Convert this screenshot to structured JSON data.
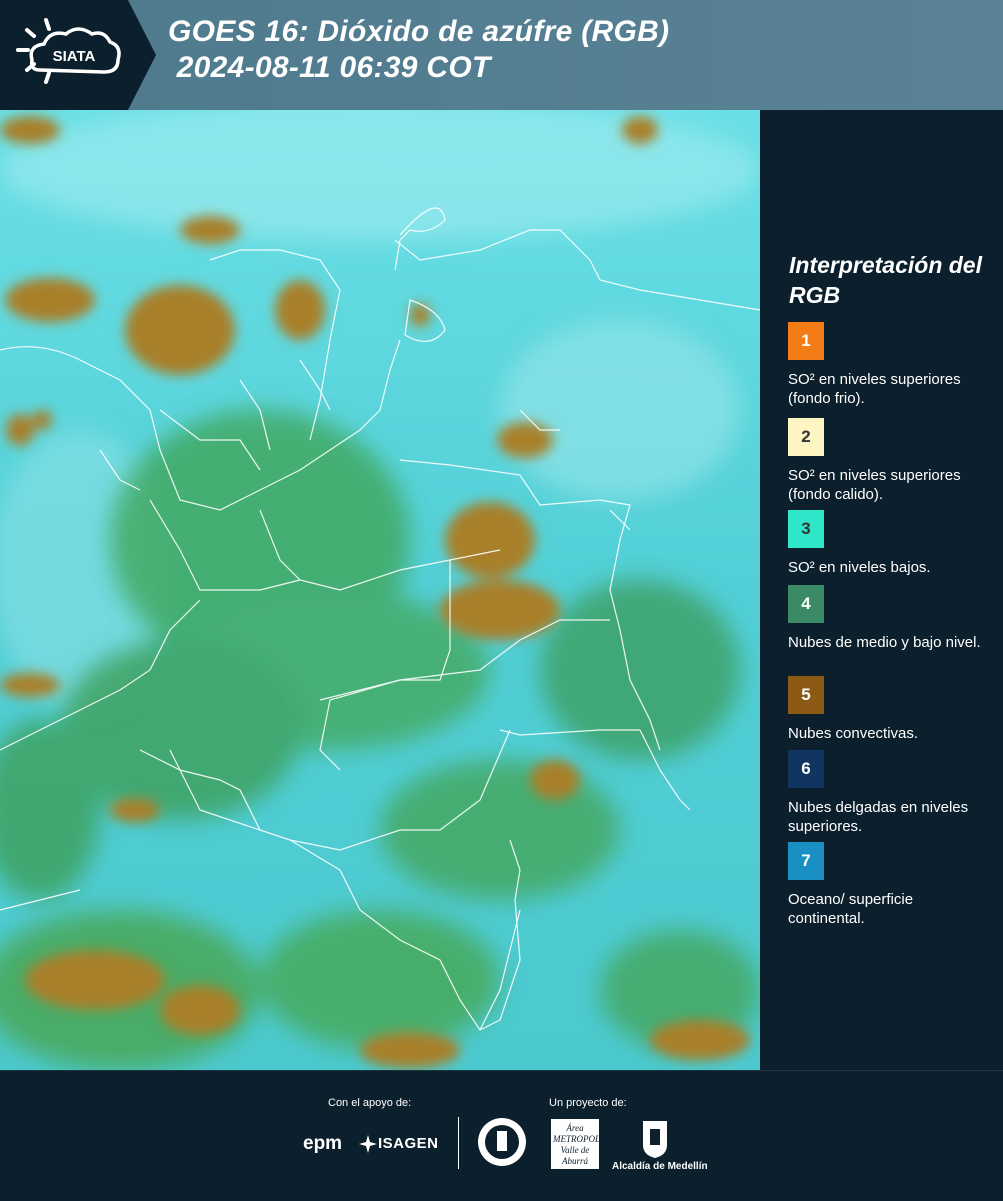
{
  "header": {
    "logo_text": "SIATA",
    "title_line1": "GOES 16: Dióxido de azúfre (RGB)",
    "title_line2": " 2024-08-11 06:39 COT"
  },
  "legend": {
    "title": "Interpretación del RGB",
    "items": [
      {
        "number": "1",
        "label": "SO² en niveles superiores (fondo frio).",
        "color": "#f47c17",
        "text_color": "#ffffff"
      },
      {
        "number": "2",
        "label": "SO² en niveles superiores (fondo calido).",
        "color": "#fdf6c3",
        "text_color": "#333333"
      },
      {
        "number": "3",
        "label": "SO² en niveles bajos.",
        "color": "#2fe6c8",
        "text_color": "#333333"
      },
      {
        "number": "4",
        "label": "Nubes de medio y bajo nivel.",
        "color": "#3a8a66",
        "text_color": "#ffffff"
      },
      {
        "number": "5",
        "label": "Nubes convectivas.",
        "color": "#8c5a14",
        "text_color": "#ffffff"
      },
      {
        "number": "6",
        "label": "Nubes delgadas en niveles superiores.",
        "color": "#0f3560",
        "text_color": "#ffffff"
      },
      {
        "number": "7",
        "label": "Oceano/ superficie continental.",
        "color": "#1a8fc4",
        "text_color": "#ffffff"
      }
    ]
  },
  "footer": {
    "support_label": "Con el apoyo de:",
    "project_label": "Un proyecto de:",
    "sponsors": [
      "epm",
      "ISAGEN"
    ],
    "partners": [
      "Área METROPOLITANA Valle de Aburrá",
      "Alcaldía de Medellín"
    ]
  },
  "map": {
    "icon": "satellite-rgb-image",
    "colors": {
      "ocean": "#58d8e0",
      "convective": "#a8802a",
      "mid_low": "#4aa860",
      "borders": "#ffffff"
    }
  }
}
